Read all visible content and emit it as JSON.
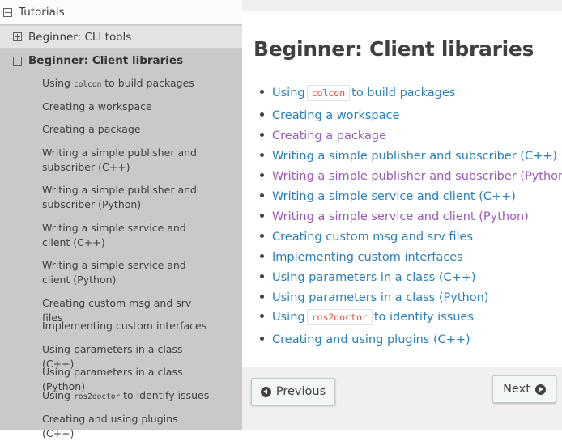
{
  "sidebar": {
    "top_item": {
      "label": "Tutorials",
      "expanded": true
    },
    "sections": [
      {
        "label": "Beginner: CLI tools",
        "expanded": false
      },
      {
        "label": "Beginner: Client libraries",
        "expanded": true
      }
    ],
    "items": [
      {
        "pre": "Using ",
        "code": "colcon",
        "post": " to build packages"
      },
      {
        "text": "Creating a workspace"
      },
      {
        "text": "Creating a package"
      },
      {
        "text": "Writing a simple publisher and subscriber (C++)"
      },
      {
        "text": "Writing a simple publisher and subscriber (Python)"
      },
      {
        "text": "Writing a simple service and client (C++)"
      },
      {
        "text": "Writing a simple service and client (Python)"
      },
      {
        "text": "Creating custom msg and srv files"
      },
      {
        "text": "Implementing custom interfaces"
      },
      {
        "text": "Using parameters in a class (C++)"
      },
      {
        "text": "Using parameters in a class (Python)"
      },
      {
        "pre": "Using ",
        "code": "ros2doctor",
        "post": " to identify issues"
      },
      {
        "text": "Creating and using plugins (C++)"
      }
    ]
  },
  "main": {
    "title": "Beginner: Client libraries",
    "links": [
      {
        "pre": "Using",
        "code": "colcon",
        "post": "to build packages",
        "visited": false
      },
      {
        "text": "Creating a workspace",
        "visited": false
      },
      {
        "text": "Creating a package",
        "visited": true
      },
      {
        "text": "Writing a simple publisher and subscriber (C++)",
        "visited": false
      },
      {
        "text": "Writing a simple publisher and subscriber (Python)",
        "visited": true
      },
      {
        "text": "Writing a simple service and client (C++)",
        "visited": false
      },
      {
        "text": "Writing a simple service and client (Python)",
        "visited": true
      },
      {
        "text": "Creating custom msg and srv files",
        "visited": false
      },
      {
        "text": "Implementing custom interfaces",
        "visited": false
      },
      {
        "text": "Using parameters in a class (C++)",
        "visited": false
      },
      {
        "text": "Using parameters in a class (Python)",
        "visited": false
      },
      {
        "pre": "Using",
        "code": "ros2doctor",
        "post": "to identify issues",
        "visited": false
      },
      {
        "text": "Creating and using plugins (C++)",
        "visited": false
      }
    ],
    "prev_label": "Previous",
    "next_label": "Next"
  },
  "colors": {
    "link": "#2980b9",
    "visited": "#9b59b6",
    "code": "#e74c3c",
    "sidebar_bg": "#c9c9c9"
  },
  "icons": {
    "collapse": "minus-box-icon",
    "expand": "plus-box-icon",
    "previous": "circle-arrow-left-icon",
    "next": "circle-arrow-right-icon"
  }
}
